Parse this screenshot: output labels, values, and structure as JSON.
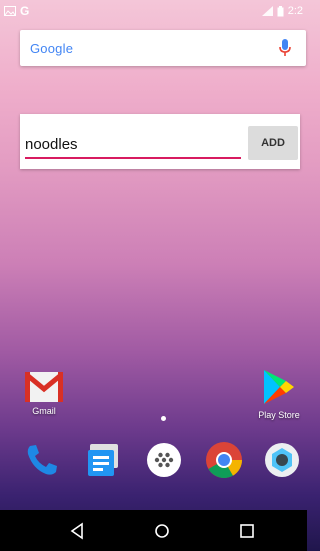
{
  "status_bar": {
    "carrier_glyph": "G",
    "clock": "2:2"
  },
  "search_bar": {
    "logo_text": "Google",
    "mic_icon": "mic-icon"
  },
  "note_widget": {
    "input_value": "noodles",
    "add_label": "ADD"
  },
  "home_apps": [
    {
      "label": "Gmail",
      "icon": "gmail-icon"
    },
    {
      "label": "Play Store",
      "icon": "play-store-icon"
    }
  ],
  "dock": [
    {
      "icon": "phone-icon"
    },
    {
      "icon": "messages-icon"
    },
    {
      "icon": "app-drawer-icon"
    },
    {
      "icon": "chrome-icon"
    },
    {
      "icon": "camera-icon"
    }
  ],
  "nav_bar": {
    "back_icon": "back-icon",
    "home_icon": "home-icon",
    "recents_icon": "recents-icon"
  },
  "colors": {
    "accent": "#d81b60",
    "google_blue": "#4285f4",
    "mic_blue": "#4285f4"
  }
}
